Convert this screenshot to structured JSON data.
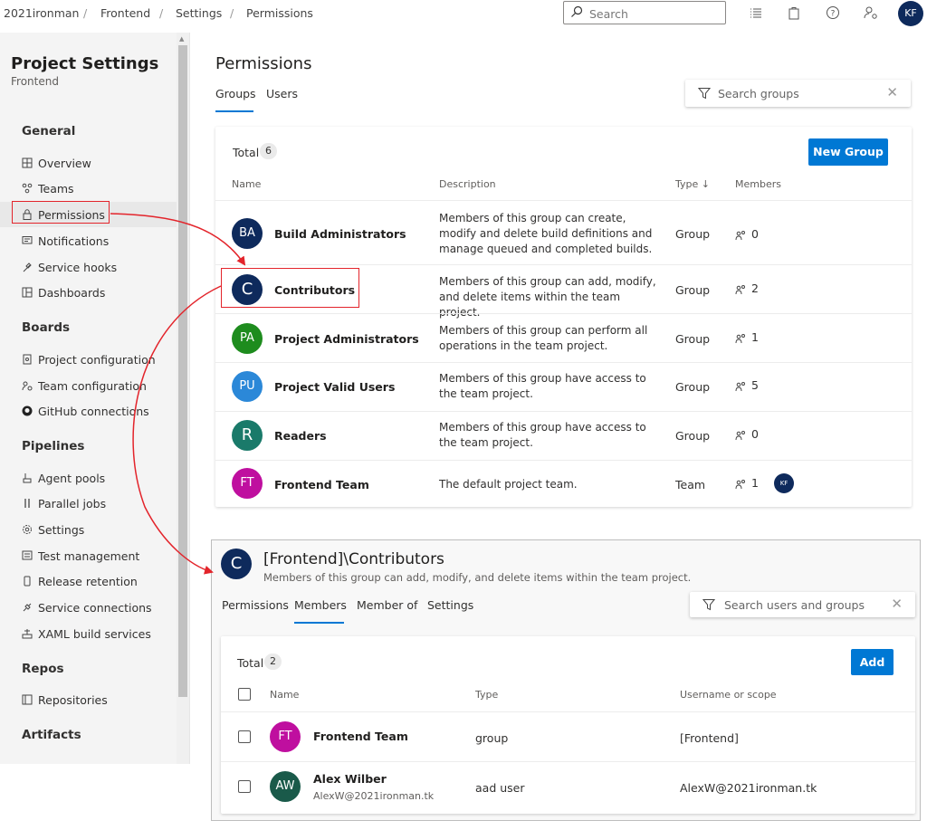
{
  "breadcrumb": [
    "2021ironman",
    "Frontend",
    "Settings",
    "Permissions"
  ],
  "top_search": {
    "placeholder": "Search"
  },
  "user": {
    "initials": "KF"
  },
  "colors": {
    "accent": "#0078d4",
    "highlight": "#e3242b"
  },
  "sidebar": {
    "title": "Project Settings",
    "subtitle": "Frontend",
    "sections": [
      {
        "heading": "General",
        "items": [
          {
            "label": "Overview",
            "icon": "overview-icon"
          },
          {
            "label": "Teams",
            "icon": "teams-icon"
          },
          {
            "label": "Permissions",
            "icon": "lock-icon",
            "selected": true
          },
          {
            "label": "Notifications",
            "icon": "notification-icon"
          },
          {
            "label": "Service hooks",
            "icon": "service-hook-icon"
          },
          {
            "label": "Dashboards",
            "icon": "dashboard-icon"
          }
        ]
      },
      {
        "heading": "Boards",
        "items": [
          {
            "label": "Project configuration",
            "icon": "document-icon"
          },
          {
            "label": "Team configuration",
            "icon": "team-config-icon"
          },
          {
            "label": "GitHub connections",
            "icon": "github-icon"
          }
        ]
      },
      {
        "heading": "Pipelines",
        "items": [
          {
            "label": "Agent pools",
            "icon": "agent-pool-icon"
          },
          {
            "label": "Parallel jobs",
            "icon": "parallel-icon"
          },
          {
            "label": "Settings",
            "icon": "gear-icon"
          },
          {
            "label": "Test management",
            "icon": "test-icon"
          },
          {
            "label": "Release retention",
            "icon": "phone-icon"
          },
          {
            "label": "Service connections",
            "icon": "plug-icon"
          },
          {
            "label": "XAML build services",
            "icon": "build-icon"
          }
        ]
      },
      {
        "heading": "Repos",
        "items": [
          {
            "label": "Repositories",
            "icon": "repo-icon"
          }
        ]
      },
      {
        "heading": "Artifacts",
        "items": []
      }
    ]
  },
  "main": {
    "title": "Permissions",
    "tabs": [
      "Groups",
      "Users"
    ],
    "active_tab": "Groups",
    "search": {
      "placeholder": "Search groups"
    },
    "groups_card": {
      "total_label": "Total",
      "total_count": "6",
      "new_button": "New Group",
      "columns": [
        "Name",
        "Description",
        "Type",
        "Members"
      ],
      "sort_indicator": "↓",
      "rows": [
        {
          "initials": "BA",
          "name": "Build Administrators",
          "description": "Members of this group can create, modify and delete build definitions and manage queued and completed builds.",
          "type": "Group",
          "members": "0",
          "color": "#0e2a5c"
        },
        {
          "initials": "C",
          "name": "Contributors",
          "description": "Members of this group can add, modify, and delete items within the team project.",
          "type": "Group",
          "members": "2",
          "color": "#0e2a5c"
        },
        {
          "initials": "PA",
          "name": "Project Administrators",
          "description": "Members of this group can perform all operations in the team project.",
          "type": "Group",
          "members": "1",
          "color": "#1e8c1e"
        },
        {
          "initials": "PU",
          "name": "Project Valid Users",
          "description": "Members of this group have access to the team project.",
          "type": "Group",
          "members": "5",
          "color": "#2b88d8"
        },
        {
          "initials": "R",
          "name": "Readers",
          "description": "Members of this group have access to the team project.",
          "type": "Group",
          "members": "0",
          "color": "#1a7a6a"
        },
        {
          "initials": "FT",
          "name": "Frontend Team",
          "description": "The default project team.",
          "type": "Team",
          "members": "1",
          "color": "#bf0f9f",
          "member_avatar": "KF"
        }
      ]
    }
  },
  "detail": {
    "initials": "C",
    "title": "[Frontend]\\Contributors",
    "description": "Members of this group can add, modify, and delete items within the team project.",
    "tabs": [
      "Permissions",
      "Members",
      "Member of",
      "Settings"
    ],
    "active_tab": "Members",
    "search": {
      "placeholder": "Search users and groups"
    },
    "members_card": {
      "total_label": "Total",
      "total_count": "2",
      "add_button": "Add",
      "columns": [
        "Name",
        "Type",
        "Username or scope"
      ],
      "rows": [
        {
          "initials": "FT",
          "name": "Frontend Team",
          "sub": "",
          "type": "group",
          "scope": "[Frontend]",
          "color": "#bf0f9f"
        },
        {
          "initials": "AW",
          "name": "Alex Wilber",
          "sub": "AlexW@2021ironman.tk",
          "type": "aad user",
          "scope": "AlexW@2021ironman.tk",
          "color": "#1a5a4a"
        }
      ]
    }
  }
}
